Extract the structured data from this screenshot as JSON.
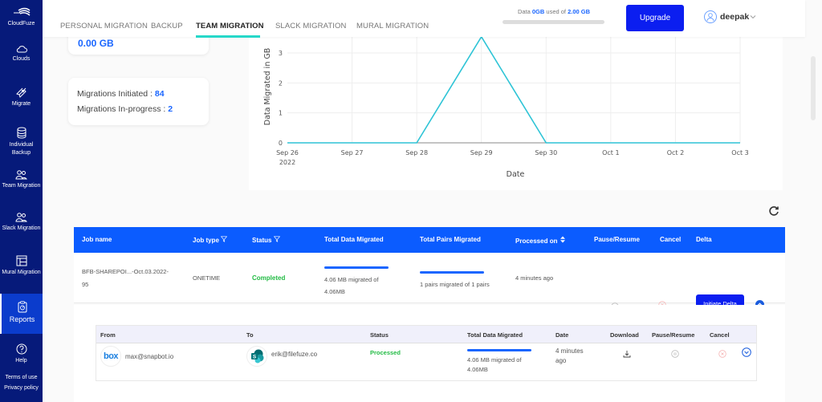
{
  "sidebar": {
    "brand": "CloudFuze",
    "items": [
      {
        "label": "Clouds",
        "icon": "cloud-icon"
      },
      {
        "label": "Migrate",
        "icon": "rocket-icon"
      },
      {
        "label": "Individual Backup",
        "icon": "database-icon"
      },
      {
        "label": "Team Migration",
        "icon": "users-icon"
      },
      {
        "label": "Slack Migration",
        "icon": "users-icon"
      },
      {
        "label": "Mural Migration",
        "icon": "layout-icon"
      },
      {
        "label": "Reports",
        "icon": "clipboard-icon",
        "active": true
      },
      {
        "label": "Help",
        "icon": "help-icon"
      }
    ],
    "links": [
      "Terms of use",
      "Privacy policy"
    ]
  },
  "topbar": {
    "tabs": [
      {
        "label": "PERSONAL MIGRATION"
      },
      {
        "label": "BACKUP"
      },
      {
        "label": "TEAM MIGRATION",
        "active": true
      },
      {
        "label": "SLACK MIGRATION"
      },
      {
        "label": "MURAL MIGRATION"
      }
    ],
    "quota": {
      "prefix": "Data",
      "used": "0GB",
      "middle": "used of",
      "total": "2.00 GB",
      "used_fraction": 0
    },
    "upgrade_label": "Upgrade",
    "user_name": "deepak"
  },
  "stats": {
    "data_total": "0.00 GB",
    "initiated_label": "Migrations Initiated :",
    "initiated_value": "84",
    "inprogress_label": "Migrations In-progress :",
    "inprogress_value": "2"
  },
  "chart_data": {
    "type": "line",
    "title": "",
    "xlabel": "Date",
    "ylabel": "Data Migrated in GB",
    "x": [
      "Sep 26",
      "Sep 27",
      "Sep 28",
      "Sep 29",
      "Sep 30",
      "Oct 1",
      "Oct 2",
      "Oct 3"
    ],
    "x_sublabel_first": "2022",
    "series": [
      {
        "name": "Data Migrated",
        "values": [
          0,
          0,
          0,
          3.54,
          0,
          0,
          0,
          0
        ],
        "color": "#2ec4d6"
      }
    ],
    "yticks": [
      0,
      1,
      2,
      3
    ],
    "ylim": [
      0,
      3.54
    ],
    "grid": true
  },
  "table": {
    "headers": [
      "Job name",
      "Job type",
      "Status",
      "Total Data Migrated",
      "Total Pairs Migrated",
      "Processed on",
      "Pause/Resume",
      "Cancel",
      "Delta"
    ],
    "rows": [
      {
        "job_name_line1": "BFB-SHAREPOI...-Oct.03.2022-",
        "job_name_line2": "95",
        "job_type": "ONETIME",
        "status": "Completed",
        "data_line1": "4.06 MB migrated of",
        "data_line2": "4.06MB",
        "data_progress": 1.0,
        "pairs": "1 pairs migrated of 1 pairs",
        "pairs_progress": 1.0,
        "processed_on": "4 minutes ago",
        "delta_label": "Initiate Delta"
      }
    ]
  },
  "detail": {
    "headers": [
      "From",
      "To",
      "Status",
      "Total Data Migrated",
      "Date",
      "Download",
      "Pause/Resume",
      "Cancel"
    ],
    "rows": [
      {
        "from_service": "box",
        "from": "max@snapbot.io",
        "to": "erik@filefuze.co",
        "status": "Processed",
        "data_line1": "4.06 MB migrated of",
        "data_line2": "4.06MB",
        "data_progress": 1.0,
        "date_line1": "4 minutes",
        "date_line2": "ago"
      }
    ]
  }
}
